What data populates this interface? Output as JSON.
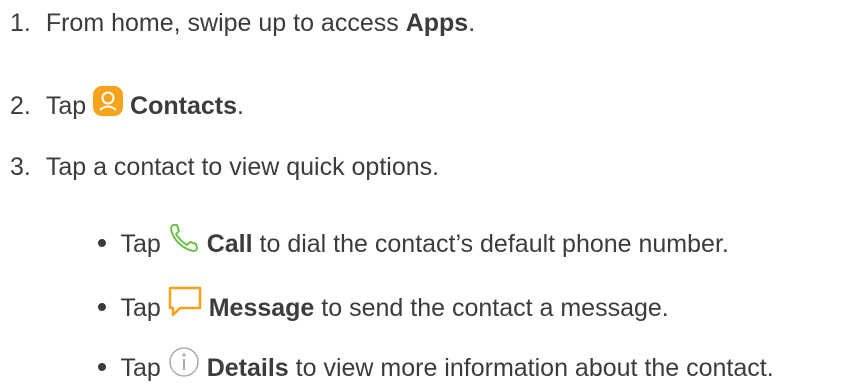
{
  "steps": [
    {
      "number": "1.",
      "prefix": "From home, swipe up to access ",
      "bold": "Apps",
      "suffix": "."
    },
    {
      "number": "2.",
      "prefix": "Tap",
      "icon": "contacts-app-icon",
      "bold": "Contacts",
      "suffix": "."
    },
    {
      "number": "3.",
      "prefix": "Tap a contact to view quick options.",
      "bold": "",
      "suffix": ""
    }
  ],
  "sub_steps": [
    {
      "prefix": "Tap",
      "icon": "phone-icon",
      "bold": "Call",
      "suffix": " to dial the contact’s default phone number."
    },
    {
      "prefix": "Tap",
      "icon": "message-icon",
      "bold": "Message",
      "suffix": " to send the contact a message."
    },
    {
      "prefix": "Tap",
      "icon": "info-icon",
      "bold": "Details",
      "suffix": " to view more information about the contact."
    }
  ],
  "colors": {
    "text": "#3c3c3c",
    "contacts_icon_bg": "#f7a21b",
    "phone_icon": "#6fc04c",
    "message_icon": "#f7a21b",
    "info_icon": "#aaaaaa"
  }
}
